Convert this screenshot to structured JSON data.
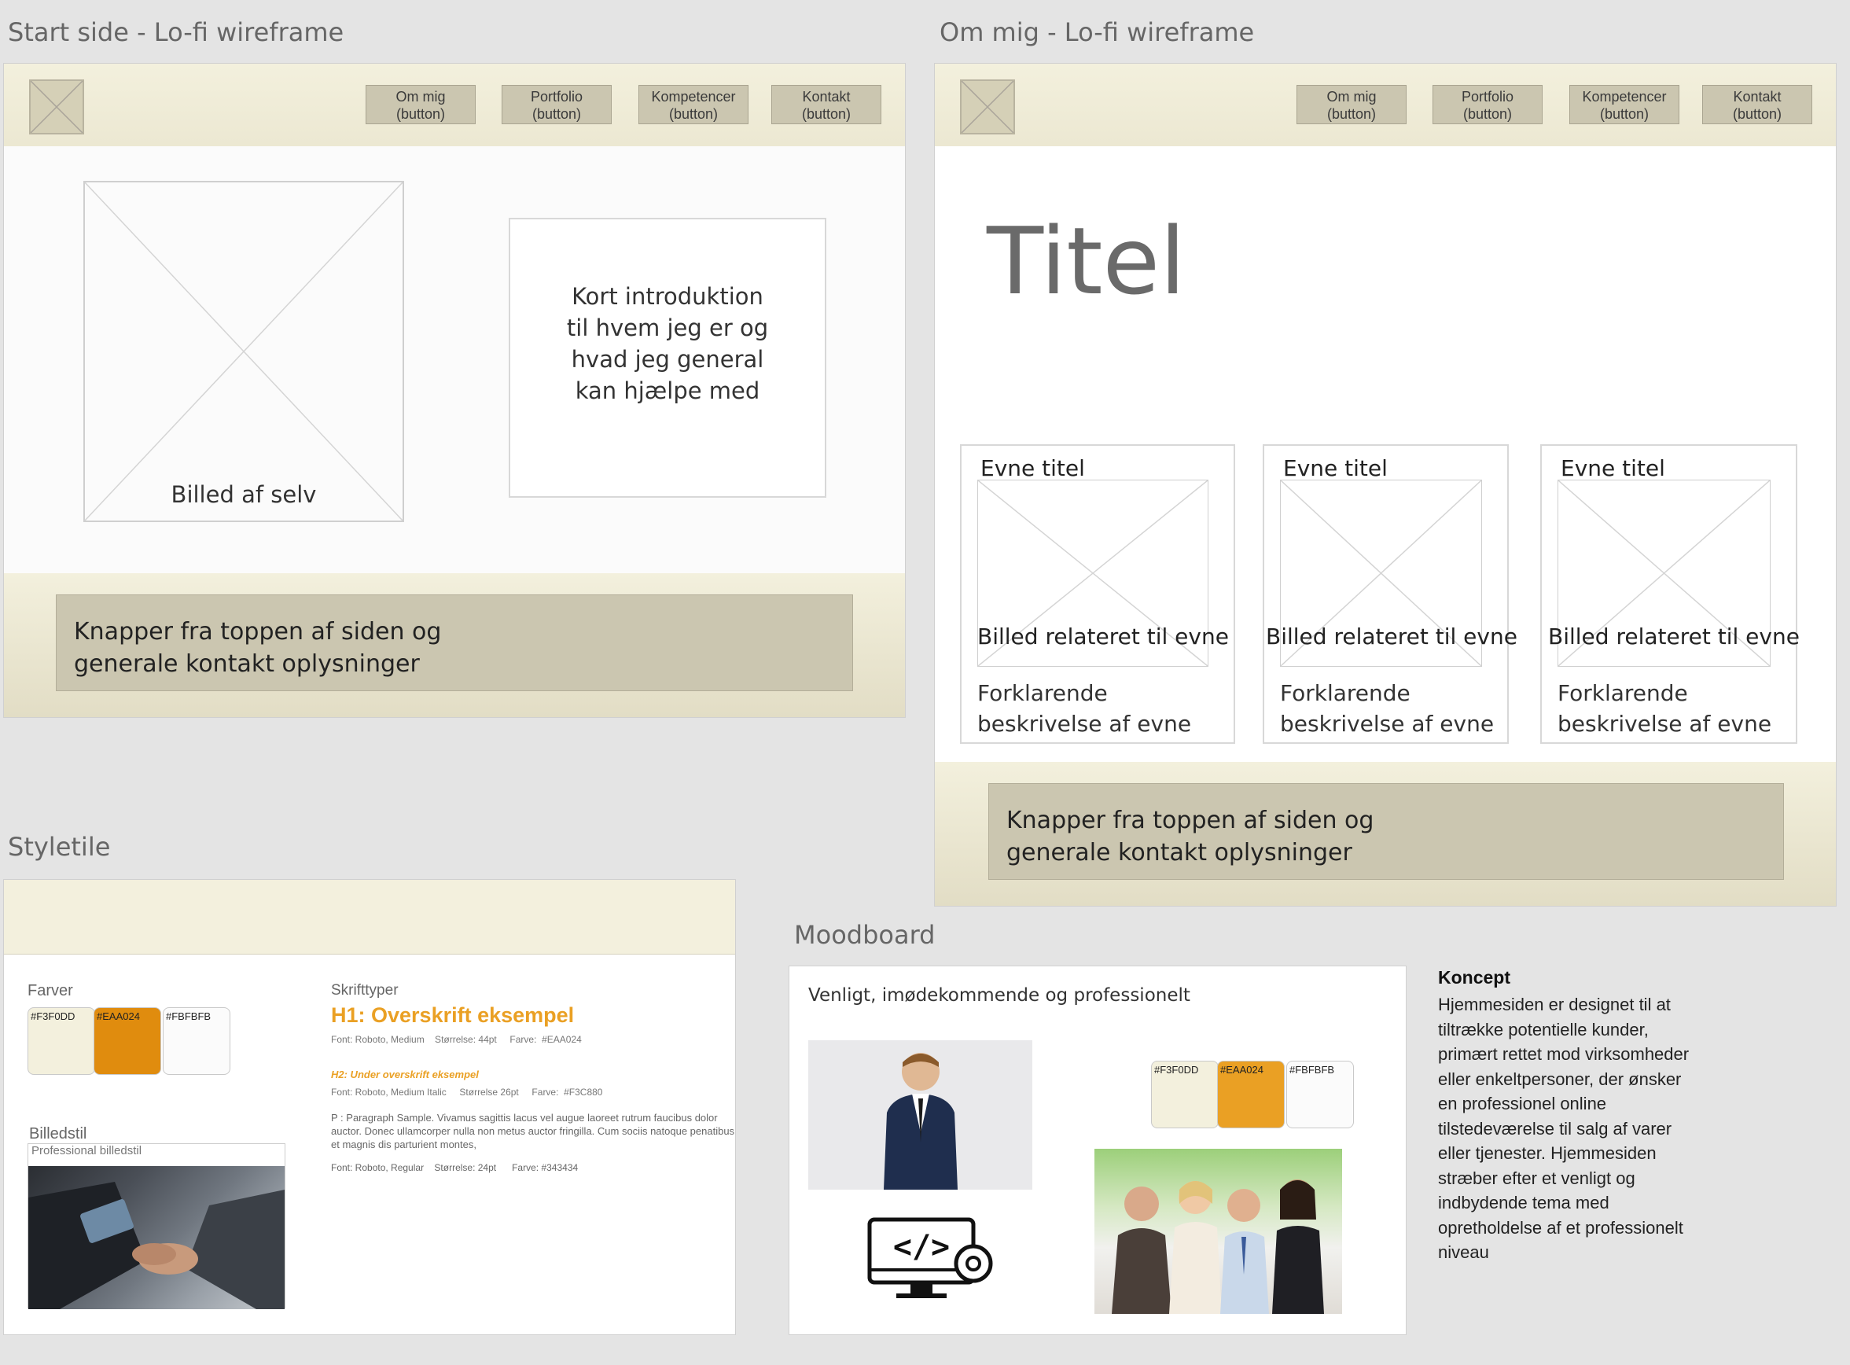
{
  "colors": {
    "cream": "#F3F0DD",
    "orange": "#EAA024",
    "offwhite": "#FBFBFB",
    "text": "#343434",
    "accent2": "#F3C880"
  },
  "startside": {
    "title": "Start side - Lo-fi wireframe",
    "nav": [
      "Om mig\n(button)",
      "Portfolio\n(button)",
      "Kompetencer\n(button)",
      "Kontakt\n(button)"
    ],
    "image_label": "Billed af selv",
    "intro": "Kort introduktion\ntil hvem jeg er og\nhvad jeg general\nkan hjælpe med",
    "footer": "Knapper fra toppen af siden og\ngenerale kontakt oplysninger"
  },
  "ommig": {
    "title": "Om mig - Lo-fi wireframe",
    "nav": [
      "Om mig\n(button)",
      "Portfolio\n(button)",
      "Kompetencer\n(button)",
      "Kontakt\n(button)"
    ],
    "heading": "Titel",
    "cards": [
      {
        "title": "Evne titel",
        "image_label": "Billed relateret til evne",
        "desc": "Forklarende\nbeskrivelse af evne"
      },
      {
        "title": "Evne titel",
        "image_label": "Billed relateret til evne",
        "desc": "Forklarende\nbeskrivelse af evne"
      },
      {
        "title": "Evne titel",
        "image_label": "Billed relateret til evne",
        "desc": "Forklarende\nbeskrivelse af evne"
      }
    ],
    "footer": "Knapper fra toppen af siden og\ngenerale kontakt oplysninger"
  },
  "styletile": {
    "title": "Styletile",
    "farver_label": "Farver",
    "swatches": [
      "#F3F0DD",
      "#EAA024",
      "#FBFBFB"
    ],
    "billedstil_label": "Billedstil",
    "billedstil_caption": "Professional billedstil",
    "skrifttyper_label": "Skrifttyper",
    "h1": "H1: Overskrift eksempel",
    "h1_meta": "Font: Roboto, Medium    Størrelse: 44pt     Farve:  #EAA024",
    "h2": "H2: Under overskrift eksempel",
    "h2_meta": "Font: Roboto, Medium Italic     Størrelse 26pt     Farve:  #F3C880",
    "p": "P : Paragraph Sample. Vivamus sagittis lacus vel augue laoreet rutrum faucibus dolor auctor. Donec ullamcorper nulla non metus auctor fringilla. Cum sociis natoque penatibus et magnis dis parturient montes,",
    "p_meta": "Font: Roboto, Regular    Størrelse: 24pt      Farve: #343434"
  },
  "moodboard": {
    "title": "Moodboard",
    "tagline": "Venligt, imødekommende og professionelt",
    "swatches": [
      "#F3F0DD",
      "#EAA024",
      "#FBFBFB"
    ],
    "code_icon_text": "</>"
  },
  "concept": {
    "heading": "Koncept",
    "body": "Hjemmesiden er designet til at\ntiltrække potentielle kunder,\nprimært rettet mod virksomheder\neller enkeltpersoner, der ønsker\nen professionel online\ntilstedeværelse til salg af varer\neller tjenester. Hjemmesiden\nstræber efter et venligt og\nindbydende tema med\nopretholdelse af et professionelt\nniveau"
  }
}
